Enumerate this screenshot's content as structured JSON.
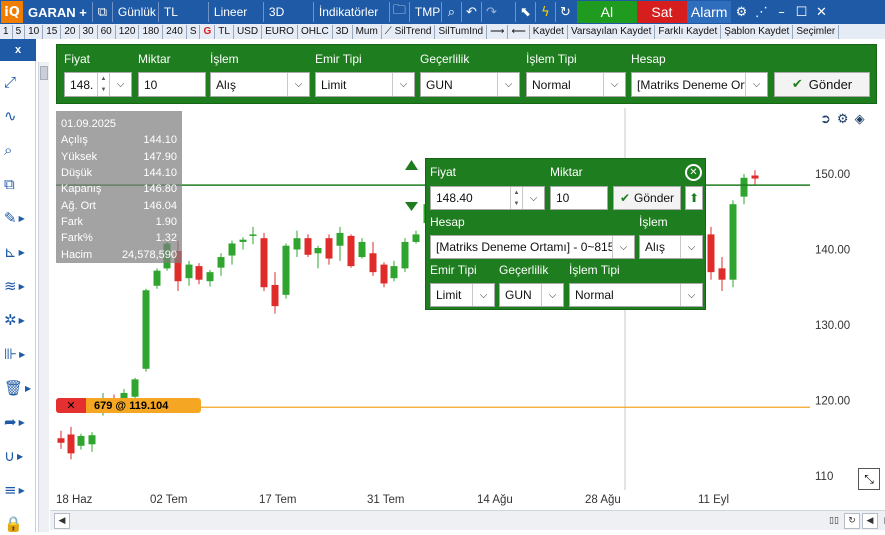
{
  "toolbar": {
    "logo": "iQ",
    "symbol": "GARAN",
    "add": "+",
    "period": "Günlük",
    "currency": "TL",
    "scale": "Lineer",
    "view3d": "3D",
    "indicators": "İndikatörler",
    "tmp": "TMP",
    "buy": "Al",
    "sell": "Sat",
    "alarm": "Alarm"
  },
  "subbar": {
    "items": [
      "1",
      "5",
      "10",
      "15",
      "20",
      "30",
      "60",
      "120",
      "180",
      "240",
      "S",
      "G",
      "TL",
      "USD",
      "EURO",
      "OHLC",
      "3D",
      "Mum",
      "SilTrend",
      "SilTumInd",
      "Kaydet",
      "Varsayılan Kaydet",
      "Farklı Kaydet",
      "Şablon Kaydet",
      "Seçimler"
    ]
  },
  "leftbar": {
    "close": "x"
  },
  "order_panel": {
    "labels": {
      "price": "Fiyat",
      "qty": "Miktar",
      "side": "İşlem",
      "order_type": "Emir Tipi",
      "validity": "Geçerlilik",
      "trade_type": "İşlem Tipi",
      "account": "Hesap"
    },
    "values": {
      "price": "148.",
      "qty": "10",
      "side": "Alış",
      "order_type": "Limit",
      "validity": "GUN",
      "trade_type": "Normal",
      "account": "[Matriks Deneme Ort"
    },
    "send": "Gönder"
  },
  "info": {
    "date": "01.09.2025",
    "rows": [
      {
        "label": "Açılış",
        "value": "144.10"
      },
      {
        "label": "Yüksek",
        "value": "147.90"
      },
      {
        "label": "Düşük",
        "value": "144.10"
      },
      {
        "label": "Kapanış",
        "value": "146.80"
      },
      {
        "label": "Ağ. Ort",
        "value": "146.04"
      },
      {
        "label": "Fark",
        "value": "1.90"
      },
      {
        "label": "Fark%",
        "value": "1.32"
      },
      {
        "label": "Hacim",
        "value": "24,578,590"
      }
    ]
  },
  "position": {
    "close": "✕",
    "text": "679 @ 119.104"
  },
  "dialog": {
    "labels": {
      "price": "Fiyat",
      "qty": "Miktar",
      "account": "Hesap",
      "side": "İşlem",
      "order_type": "Emir Tipi",
      "validity": "Geçerlilik",
      "trade_type": "İşlem Tipi"
    },
    "values": {
      "price": "148.40",
      "qty": "10",
      "account": "[Matriks Deneme Ortamı] - 0~815",
      "side": "Alış",
      "order_type": "Limit",
      "validity": "GUN",
      "trade_type": "Normal"
    },
    "send": "Gönder"
  },
  "colors": {
    "up": "#2fa52f",
    "down": "#e02b2b",
    "panel": "#1e7d1e",
    "toolbar": "#1f5aa6",
    "limit_line": "#1e7d1e",
    "position_line": "#f5a623"
  },
  "chart_data": {
    "type": "candlestick",
    "x_ticks": [
      "18 Haz",
      "02 Tem",
      "17 Tem",
      "31 Tem",
      "14 Ağu",
      "28 Ağu",
      "11 Eyl"
    ],
    "y_ticks": [
      "150.00",
      "140.00",
      "130.00",
      "120.00",
      "110"
    ],
    "ylim": [
      110,
      153
    ],
    "limit_price": 148.4,
    "position_price": 119.104,
    "candles": [
      {
        "o": 115.0,
        "h": 116.0,
        "l": 113.6,
        "c": 114.4
      },
      {
        "o": 115.5,
        "h": 116.5,
        "l": 112.2,
        "c": 113.0
      },
      {
        "o": 114.0,
        "h": 115.6,
        "l": 113.5,
        "c": 115.3
      },
      {
        "o": 114.2,
        "h": 115.8,
        "l": 113.2,
        "c": 115.4
      },
      {
        "o": 119.0,
        "h": 121.0,
        "l": 118.0,
        "c": 119.5
      },
      {
        "o": 120.0,
        "h": 120.8,
        "l": 118.8,
        "c": 119.3
      },
      {
        "o": 119.1,
        "h": 121.5,
        "l": 118.6,
        "c": 121.0
      },
      {
        "o": 120.5,
        "h": 123.0,
        "l": 119.8,
        "c": 122.8
      },
      {
        "o": 124.2,
        "h": 134.8,
        "l": 123.8,
        "c": 134.6
      },
      {
        "o": 135.2,
        "h": 137.5,
        "l": 134.8,
        "c": 137.2
      },
      {
        "o": 137.5,
        "h": 141.0,
        "l": 137.2,
        "c": 140.8
      },
      {
        "o": 139.8,
        "h": 141.2,
        "l": 134.5,
        "c": 135.8
      },
      {
        "o": 136.2,
        "h": 138.5,
        "l": 135.2,
        "c": 138.0
      },
      {
        "o": 137.8,
        "h": 138.2,
        "l": 135.4,
        "c": 136.0
      },
      {
        "o": 135.8,
        "h": 137.3,
        "l": 135.1,
        "c": 137.0
      },
      {
        "o": 137.6,
        "h": 139.5,
        "l": 136.5,
        "c": 139.0
      },
      {
        "o": 139.2,
        "h": 141.2,
        "l": 138.0,
        "c": 140.8
      },
      {
        "o": 141.0,
        "h": 141.6,
        "l": 140.0,
        "c": 141.3
      },
      {
        "o": 141.8,
        "h": 143.0,
        "l": 140.7,
        "c": 142.0
      },
      {
        "o": 141.5,
        "h": 142.2,
        "l": 134.5,
        "c": 135.0
      },
      {
        "o": 135.3,
        "h": 137.0,
        "l": 131.5,
        "c": 132.5
      },
      {
        "o": 134.0,
        "h": 140.8,
        "l": 133.5,
        "c": 140.5
      },
      {
        "o": 140.0,
        "h": 142.5,
        "l": 139.0,
        "c": 141.5
      },
      {
        "o": 141.5,
        "h": 142.0,
        "l": 139.0,
        "c": 139.3
      },
      {
        "o": 139.5,
        "h": 140.5,
        "l": 137.5,
        "c": 140.2
      },
      {
        "o": 141.5,
        "h": 142.0,
        "l": 138.0,
        "c": 138.8
      },
      {
        "o": 140.5,
        "h": 143.0,
        "l": 138.5,
        "c": 142.2
      },
      {
        "o": 141.8,
        "h": 142.0,
        "l": 137.6,
        "c": 137.8
      },
      {
        "o": 139.0,
        "h": 141.5,
        "l": 138.8,
        "c": 141.0
      },
      {
        "o": 139.5,
        "h": 141.0,
        "l": 136.5,
        "c": 137.0
      },
      {
        "o": 138.0,
        "h": 138.3,
        "l": 135.0,
        "c": 135.5
      },
      {
        "o": 136.2,
        "h": 138.5,
        "l": 135.8,
        "c": 137.8
      },
      {
        "o": 137.5,
        "h": 141.5,
        "l": 137.0,
        "c": 141.0
      },
      {
        "o": 141.0,
        "h": 142.5,
        "l": 140.8,
        "c": 142.0
      },
      {
        "o": 143.5,
        "h": 146.5,
        "l": 143.0,
        "c": 146.0
      },
      {
        "o": 144.1,
        "h": 147.9,
        "l": 144.1,
        "c": 146.8
      },
      {
        "o": 149.5,
        "h": 151.0,
        "l": 148.5,
        "c": 150.5
      }
    ],
    "right_candles": [
      {
        "o": 142.0,
        "h": 143.0,
        "l": 136.0,
        "c": 137.0
      },
      {
        "o": 137.5,
        "h": 139.0,
        "l": 134.5,
        "c": 136.0
      },
      {
        "o": 136.0,
        "h": 146.5,
        "l": 135.0,
        "c": 146.0
      },
      {
        "o": 147.0,
        "h": 150.0,
        "l": 146.0,
        "c": 149.5
      },
      {
        "o": 149.8,
        "h": 150.5,
        "l": 148.5,
        "c": 149.4
      }
    ]
  }
}
